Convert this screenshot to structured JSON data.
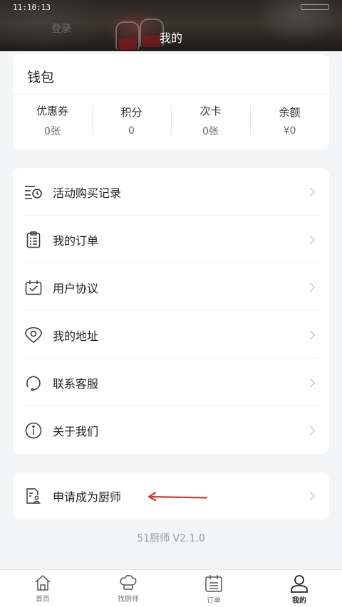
{
  "status": {
    "time": "11:10:13"
  },
  "header": {
    "title": "我的",
    "ghost_text": "登录"
  },
  "wallet": {
    "title": "钱包",
    "stats": [
      {
        "label": "优惠券",
        "value": "0张"
      },
      {
        "label": "积分",
        "value": "0"
      },
      {
        "label": "次卡",
        "value": "0张"
      },
      {
        "label": "余额",
        "value": "¥0"
      }
    ]
  },
  "menu": {
    "items": [
      {
        "label": "活动购买记录",
        "icon": "purchase-record-icon"
      },
      {
        "label": "我的订单",
        "icon": "clipboard-icon"
      },
      {
        "label": "用户协议",
        "icon": "agreement-icon"
      },
      {
        "label": "我的地址",
        "icon": "location-icon"
      },
      {
        "label": "联系客服",
        "icon": "customer-service-icon"
      },
      {
        "label": "关于我们",
        "icon": "info-icon"
      }
    ]
  },
  "chef_apply": {
    "label": "申请成为厨师",
    "icon": "apply-document-icon"
  },
  "version": "51厨师 V2.1.0",
  "tabbar": {
    "tabs": [
      {
        "label": "首页",
        "icon": "home-icon"
      },
      {
        "label": "找厨师",
        "icon": "chef-hat-icon"
      },
      {
        "label": "订单",
        "icon": "calendar-list-icon"
      },
      {
        "label": "我的",
        "icon": "person-icon",
        "active": true
      }
    ]
  },
  "colors": {
    "accent_arrow": "#d8382e",
    "page_bg": "#f4f5f7"
  }
}
